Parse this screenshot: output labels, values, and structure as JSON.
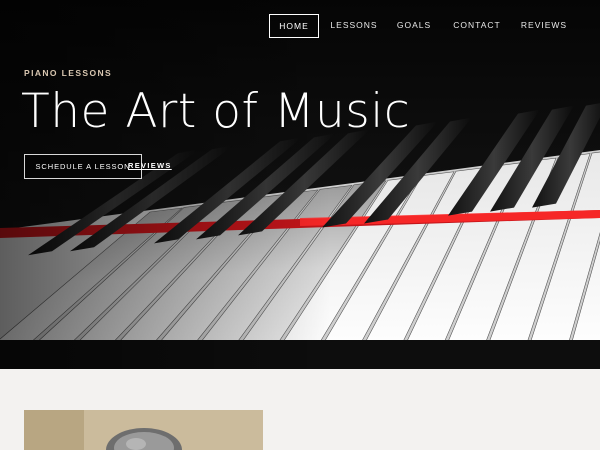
{
  "nav": {
    "items": [
      {
        "label": "HOME",
        "active": true
      },
      {
        "label": "LESSONS",
        "active": false
      },
      {
        "label": "GOALS",
        "active": false
      },
      {
        "label": "CONTACT",
        "active": false
      },
      {
        "label": "REVIEWS",
        "active": false
      }
    ]
  },
  "hero": {
    "eyebrow": "PIANO LESSONS",
    "title": "The Art of Music",
    "schedule_button": "SCHEDULE A LESSON",
    "reviews_link": "REVIEWS",
    "image_icon": "piano-keyboard-image"
  },
  "about": {
    "photo_icon": "portrait-photo"
  },
  "colors": {
    "page_background": "#f3f2f0",
    "hero_text": "#ffffff",
    "eyebrow": "#d9c7b1",
    "felt_accent": "#d2161b"
  }
}
